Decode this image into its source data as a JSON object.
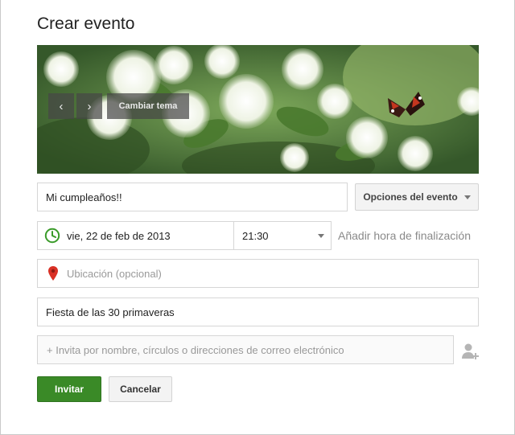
{
  "dialog": {
    "title": "Crear evento"
  },
  "banner": {
    "change_theme_label": "Cambiar tema",
    "prev_icon": "‹",
    "next_icon": "›"
  },
  "form": {
    "event_name_value": "Mi cumpleaños!!",
    "options_label": "Opciones del evento",
    "date_value": "vie, 22 de feb de 2013",
    "time_value": "21:30",
    "add_end_time_label": "Añadir hora de finalización",
    "location_placeholder": "Ubicación (opcional)",
    "description_value": "Fiesta de las 30 primaveras",
    "invite_placeholder": "+ Invita por nombre, círculos o direcciones de correo electrónico"
  },
  "actions": {
    "invite_label": "Invitar",
    "cancel_label": "Cancelar"
  },
  "colors": {
    "primary_green": "#3a8a27",
    "clock_green": "#3a9b2a",
    "pin_red": "#d93025"
  }
}
